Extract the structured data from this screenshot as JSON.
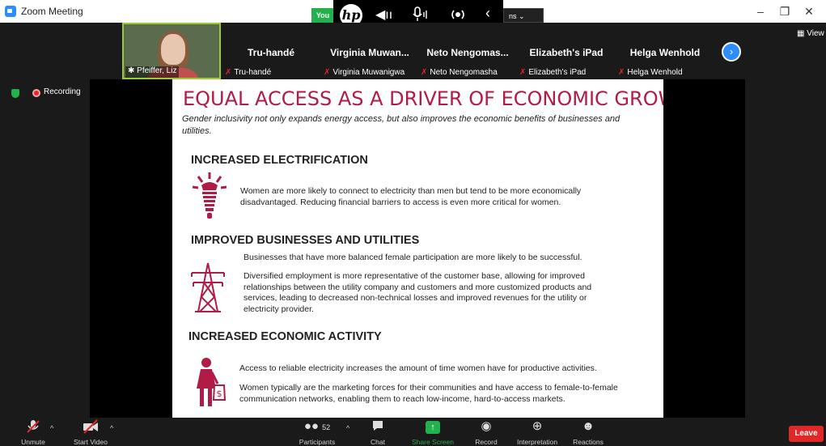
{
  "window": {
    "title": "Zoom Meeting",
    "minimize": "–",
    "restore": "❐",
    "close": "✕"
  },
  "floating_bar": {
    "share_pill": "You",
    "brand": "hp",
    "views_label": "ns ⌄"
  },
  "participants": [
    {
      "name": "",
      "label": "Pfeiffer, Liz",
      "video": true
    },
    {
      "name": "Tru-handé",
      "label": "Tru-handé"
    },
    {
      "name": "Virginia  Muwan...",
      "label": "Virginia Muwanigwa"
    },
    {
      "name": "Neto  Nengomas...",
      "label": "Neto Nengomasha"
    },
    {
      "name": "Elizabeth's iPad",
      "label": "Elizabeth's iPad"
    },
    {
      "name": "Helga Wenhold",
      "label": "Helga Wenhold"
    }
  ],
  "view_button": "View",
  "recording": {
    "label": "Recording"
  },
  "slide": {
    "title": "EQUAL ACCESS AS A DRIVER OF ECONOMIC GROWTH",
    "subtitle": "Gender inclusivity not only expands energy access, but also improves the economic benefits of businesses and utilities.",
    "sections": [
      {
        "heading": "INCREASED ELECTRIFICATION",
        "paragraphs": [
          "Women are more likely to connect to electricity than men but tend to be more economically disadvantaged. Reducing financial barriers to access is even more critical for women."
        ]
      },
      {
        "heading": "IMPROVED BUSINESSES AND UTILITIES",
        "paragraphs": [
          "Businesses that have more balanced female participation are more likely to be successful.",
          "Diversified employment is more representative of the customer base, allowing for improved relationships between the utility company and customers and more customized products and services, leading to decreased non-technical losses and improved revenues for the utility or electricity provider."
        ]
      },
      {
        "heading": "INCREASED ECONOMIC ACTIVITY",
        "paragraphs": [
          "Access to reliable electricity increases the amount of time women have for productive activities.",
          "Women typically are the marketing forces for their communities and have access to female-to-female communication networks, enabling them to reach low-income, hard-to-access markets."
        ]
      }
    ],
    "accent_color": "#b01c45"
  },
  "toolbar": {
    "unmute": "Unmute",
    "start_video": "Start Video",
    "participants": "Participants",
    "participants_count": "52",
    "chat": "Chat",
    "share_screen": "Share Screen",
    "record": "Record",
    "interpretation": "Interpretation",
    "reactions": "Reactions",
    "leave": "Leave"
  }
}
